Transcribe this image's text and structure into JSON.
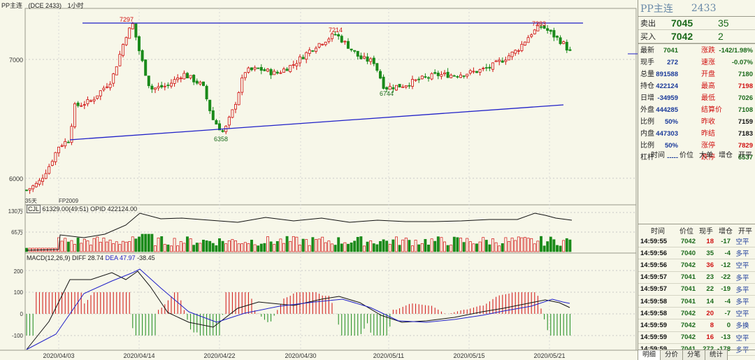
{
  "header": {
    "name": "PP主连",
    "code": "(DCE 2433)",
    "period": "1小时"
  },
  "main_panel": {
    "y_labels": [
      "7000",
      "6000"
    ],
    "highs": [
      "7297",
      "7214",
      "7283"
    ],
    "lows": [
      "6744",
      "6358"
    ],
    "left_marks": [
      "35天",
      "FP2009"
    ]
  },
  "volume_panel": {
    "label": "CJL",
    "vol": "61329.00(49:51)",
    "opid": "OPID 422124.00",
    "y_labels": [
      "130万",
      "65万"
    ]
  },
  "macd_panel": {
    "label": "MACD(12,26,9)",
    "diff": "DIFF 28.74",
    "dea": "DEA 47.97",
    "macd": "-38.45",
    "y_labels": [
      "200",
      "100",
      "0",
      "-100"
    ]
  },
  "x_axis": [
    "2020/04/03",
    "2020/04/14",
    "2020/04/22",
    "2020/04/30",
    "2020/05/11",
    "2020/05/15",
    "2020/05/21"
  ],
  "colors": {
    "up": "#d01010",
    "down": "#1a8a1a",
    "trend": "#2020c8",
    "bg": "#f7f7e9"
  },
  "chart_data": {
    "type": "candlestick",
    "kline_highlights": {
      "high": [
        7297,
        7214,
        7283
      ],
      "low": [
        6744,
        6358
      ]
    },
    "y_range": [
      5880,
      7340
    ],
    "trend_lines": [
      {
        "from": "2020/04/07",
        "to": "2020/05/21",
        "level": 7297
      },
      {
        "from": "2020/04/07",
        "to": "2020/05/21",
        "start": 6330,
        "end": 6620
      }
    ],
    "volume": {
      "last": "61329.00",
      "opid": "422124.00"
    },
    "macd": {
      "diff": 28.74,
      "dea": 47.97,
      "macd": -38.45
    }
  },
  "quote": {
    "title": "PP主连",
    "code": "2433",
    "sell_label": "卖出",
    "sell_price": "7045",
    "sell_vol": "35",
    "buy_label": "买入",
    "buy_price": "7042",
    "buy_vol": "2"
  },
  "stats": [
    {
      "l": "最新",
      "lv": "7041",
      "lc": "g",
      "r": "涨跌",
      "rv": "-142/1.98%",
      "rc": "g"
    },
    {
      "l": "现手",
      "lv": "272",
      "lc": "b",
      "r": "速涨",
      "rv": "-0.07%",
      "rc": "g"
    },
    {
      "l": "总量",
      "lv": "891588",
      "lc": "b",
      "r": "开盘",
      "rv": "7180",
      "rc": "g"
    },
    {
      "l": "持仓",
      "lv": "422124",
      "lc": "b",
      "r": "最高",
      "rv": "7198",
      "rc": "r"
    },
    {
      "l": "日增",
      "lv": "-34959",
      "lc": "b",
      "r": "最低",
      "rv": "7026",
      "rc": "g"
    },
    {
      "l": "外盘",
      "lv": "444285",
      "lc": "b",
      "r": "结算价",
      "rv": "7108",
      "rc": "g"
    },
    {
      "l": "比例",
      "lv": "50%",
      "lc": "b",
      "r": "昨收",
      "rv": "7159",
      "rc": "k"
    },
    {
      "l": "内盘",
      "lv": "447303",
      "lc": "b",
      "r": "昨结",
      "rv": "7183",
      "rc": "k"
    },
    {
      "l": "比例",
      "lv": "50%",
      "lc": "b",
      "r": "涨停",
      "rv": "7829",
      "rc": "r"
    },
    {
      "l": "杠杆",
      "lv": "-----",
      "lc": "b",
      "r": "跌停",
      "rv": "6537",
      "rc": "g"
    }
  ],
  "trades_header_top": [
    "时间",
    "价位",
    "大单",
    "增仓",
    "开平"
  ],
  "trades_header": [
    "时间",
    "价位",
    "现手",
    "增仓",
    "开平"
  ],
  "trades": [
    {
      "t": "14:59:55",
      "p": "7042",
      "v": "18",
      "vc": "r",
      "c": "-17",
      "n": "空平"
    },
    {
      "t": "14:59:56",
      "p": "7040",
      "v": "35",
      "vc": "g",
      "c": "-4",
      "n": "多平"
    },
    {
      "t": "14:59:56",
      "p": "7042",
      "v": "36",
      "vc": "r",
      "c": "-12",
      "n": "空平"
    },
    {
      "t": "14:59:57",
      "p": "7041",
      "v": "23",
      "vc": "g",
      "c": "-22",
      "n": "多平"
    },
    {
      "t": "14:59:57",
      "p": "7041",
      "v": "22",
      "vc": "g",
      "c": "-19",
      "n": "多平"
    },
    {
      "t": "14:59:58",
      "p": "7041",
      "v": "14",
      "vc": "g",
      "c": "-4",
      "n": "多平"
    },
    {
      "t": "14:59:58",
      "p": "7042",
      "v": "20",
      "vc": "r",
      "c": "-7",
      "n": "空平"
    },
    {
      "t": "14:59:59",
      "p": "7042",
      "v": "8",
      "vc": "r",
      "c": "0",
      "n": "多换"
    },
    {
      "t": "14:59:59",
      "p": "7042",
      "v": "16",
      "vc": "r",
      "c": "-13",
      "n": "空平"
    },
    {
      "t": "14:59:59",
      "p": "7041",
      "v": "272",
      "vc": "g",
      "c": "-178",
      "n": "多平"
    }
  ],
  "tabs": [
    "明细",
    "分价",
    "分笔",
    "统计"
  ]
}
